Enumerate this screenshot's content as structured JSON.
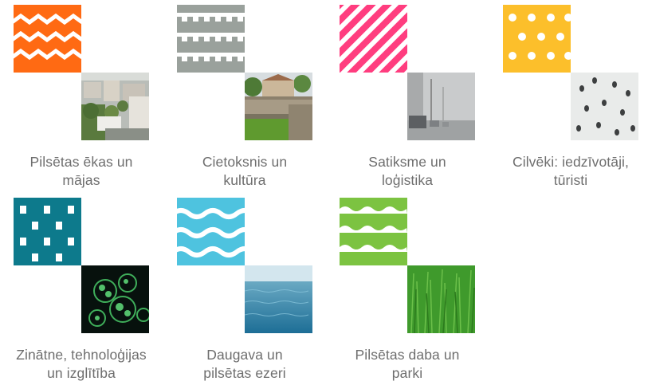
{
  "categories": [
    {
      "label": "Pilsētas ēkas un mājas",
      "line1": "Pilsētas ēkas un",
      "line2": "mājas",
      "pattern": "zigzag-pattern-icon",
      "color": "#ff6a13",
      "photo": "old-town-buildings-photo"
    },
    {
      "label": "Cietoksnis un kultūra",
      "line1": "Cietoksnis un",
      "line2": "kultūra",
      "pattern": "battlement-pattern-icon",
      "color": "#9aa19c",
      "photo": "fortress-wall-photo"
    },
    {
      "label": "Satiksme un loģistika",
      "line1": "Satiksme un",
      "line2": "loģistika",
      "pattern": "diagonal-stripes-pattern-icon",
      "color": "#ff3d7f",
      "photo": "foggy-street-traffic-photo"
    },
    {
      "label": "Cilvēki: iedzīvotāji, tūristi",
      "line1": "Cilvēki: iedzīvotāji,",
      "line2": "tūristi",
      "pattern": "polka-dot-pattern-icon",
      "color": "#fcbf2b",
      "photo": "people-walking-aerial-photo"
    },
    {
      "label": "Zinātne, tehnoloģijas un izglītība",
      "line1": "Zinātne, tehnoloģijas",
      "line2": "un izglītība",
      "pattern": "lattice-pattern-icon",
      "color": "#0d7a8c",
      "photo": "cells-microscope-photo"
    },
    {
      "label": "Daugava un pilsētas ezeri",
      "line1": "Daugava un",
      "line2": "pilsētas ezeri",
      "pattern": "wave-pattern-icon",
      "color": "#4ec3df",
      "photo": "water-surface-photo"
    },
    {
      "label": "Pilsētas daba un parki",
      "line1": "Pilsētas daba un",
      "line2": "parki",
      "pattern": "scallop-pattern-icon",
      "color": "#7cc341",
      "photo": "green-grass-photo"
    }
  ]
}
